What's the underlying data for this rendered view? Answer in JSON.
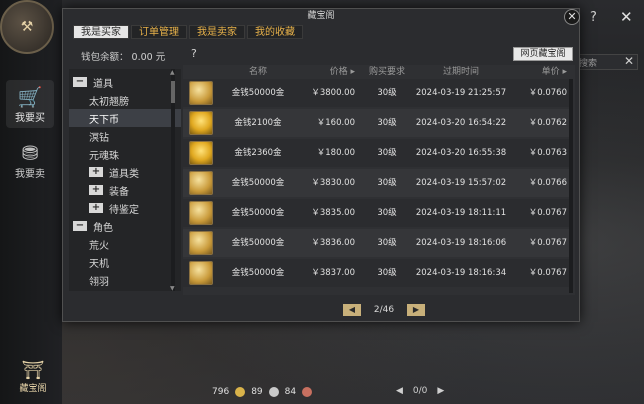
{
  "window": {
    "title": "藏宝阁",
    "help_glyph": "?",
    "close_glyph": "✕"
  },
  "sidebar": {
    "buy_label": "我要买",
    "sell_label": "我要卖",
    "treasure_label": "藏宝阁"
  },
  "background": {
    "search_placeholder": "搜索"
  },
  "tabs": [
    {
      "label": "我是买家",
      "active": true
    },
    {
      "label": "订单管理",
      "active": false
    },
    {
      "label": "我是卖家",
      "active": false
    },
    {
      "label": "我的收藏",
      "active": false
    }
  ],
  "wallet": {
    "label": "钱包余额：",
    "value": "0.00 元"
  },
  "web_button_label": "网页藏宝阁",
  "tree": [
    {
      "type": "group",
      "sign": "−",
      "label": "道具"
    },
    {
      "type": "leaf",
      "label": "太初翘膀"
    },
    {
      "type": "leaf",
      "label": "天下币",
      "selected": true
    },
    {
      "type": "leaf",
      "label": "溟钻"
    },
    {
      "type": "leaf",
      "label": "元魂珠"
    },
    {
      "type": "sub",
      "sign": "+",
      "label": "道具类"
    },
    {
      "type": "sub",
      "sign": "+",
      "label": "装备"
    },
    {
      "type": "sub",
      "sign": "+",
      "label": "待鉴定"
    },
    {
      "type": "group",
      "sign": "−",
      "label": "角色"
    },
    {
      "type": "leaf",
      "label": "荒火"
    },
    {
      "type": "leaf",
      "label": "天机"
    },
    {
      "type": "leaf",
      "label": "翎羽"
    }
  ],
  "table": {
    "headers": {
      "name": "名称",
      "price": "价格 ▸",
      "requirement": "购买要求",
      "expiry": "过期时间",
      "unit": "单价 ▸"
    },
    "rows": [
      {
        "name": "金钱50000金",
        "price": "￥3800.00",
        "req": "30级",
        "expiry": "2024-03-19 21:25:57",
        "unit": "￥0.0760",
        "icon": "gold-pile-icon"
      },
      {
        "name": "金钱2100金",
        "price": "￥160.00",
        "req": "30级",
        "expiry": "2024-03-20 16:54:22",
        "unit": "￥0.0762",
        "icon": "coin-stack-icon"
      },
      {
        "name": "金钱2360金",
        "price": "￥180.00",
        "req": "30级",
        "expiry": "2024-03-20 16:55:38",
        "unit": "￥0.0763",
        "icon": "coin-stack-icon"
      },
      {
        "name": "金钱50000金",
        "price": "￥3830.00",
        "req": "30级",
        "expiry": "2024-03-19 15:57:02",
        "unit": "￥0.0766",
        "icon": "gold-pile-icon"
      },
      {
        "name": "金钱50000金",
        "price": "￥3835.00",
        "req": "30级",
        "expiry": "2024-03-19 18:11:11",
        "unit": "￥0.0767",
        "icon": "gold-pile-icon"
      },
      {
        "name": "金钱50000金",
        "price": "￥3836.00",
        "req": "30级",
        "expiry": "2024-03-19 18:16:06",
        "unit": "￥0.0767",
        "icon": "gold-pile-icon"
      },
      {
        "name": "金钱50000金",
        "price": "￥3837.00",
        "req": "30级",
        "expiry": "2024-03-19 18:16:34",
        "unit": "￥0.0767",
        "icon": "gold-pile-icon"
      }
    ]
  },
  "pager": {
    "prev": "◀",
    "page_text": "2/46",
    "next": "▶"
  },
  "currency": {
    "gold": "796",
    "silver": "89",
    "copper": "84"
  },
  "bottom_pager": {
    "prev": "◀",
    "text": "0/0",
    "next": "▶"
  },
  "colors": {
    "accent": "#e8b24a",
    "panel": "#2b2c2f"
  }
}
